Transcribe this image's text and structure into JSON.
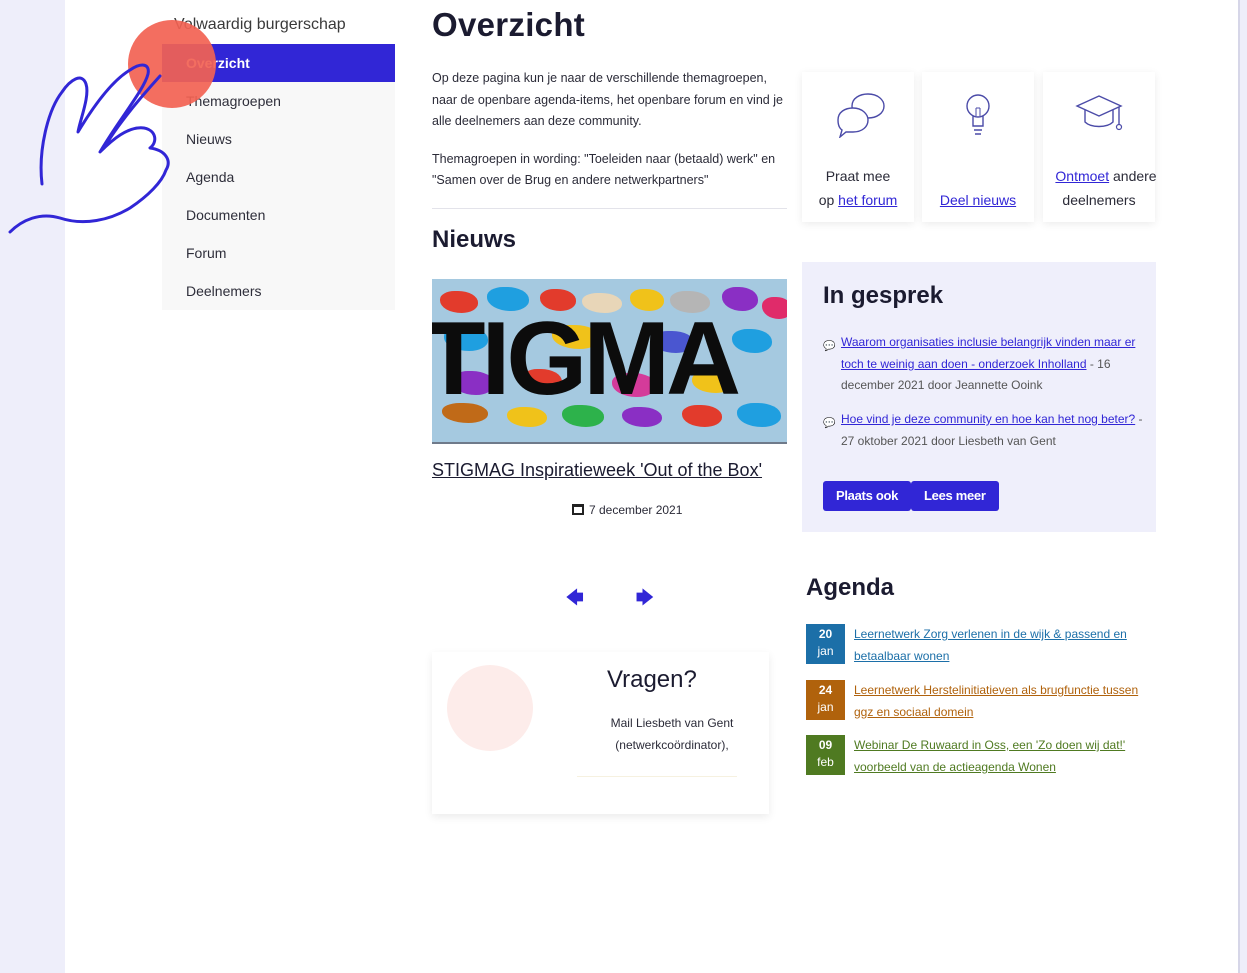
{
  "sidebar": {
    "heading": "Volwaardig burgerschap",
    "items": [
      {
        "label": "Overzicht"
      },
      {
        "label": "Themagroepen"
      },
      {
        "label": "Nieuws"
      },
      {
        "label": "Agenda"
      },
      {
        "label": "Documenten"
      },
      {
        "label": "Forum"
      },
      {
        "label": "Deelnemers"
      }
    ]
  },
  "main": {
    "title": "Overzicht",
    "intro_1": "Op deze pagina kun je naar de verschillende themagroepen, naar de openbare agenda-items, het openbare forum en vind je alle deelnemers aan deze community.",
    "intro_2": "Themagroepen in wording: \"Toeleiden naar (betaald) werk\" en \"Samen over de Brug en andere netwerkpartners\"",
    "news_heading": "Nieuws",
    "news_image_word": "TIGMA",
    "news_link": "STIGMAG Inspiratieweek 'Out of the Box'",
    "news_date": "7 december 2021",
    "prev_arrow": "🡄",
    "next_arrow": "🡆"
  },
  "vragen": {
    "title": "Vragen?",
    "text_1": "Mail  Liesbeth van Gent",
    "text_2": "(netwerkcoördinator),"
  },
  "cards": [
    {
      "pre": "Praat mee",
      "pre2": "op ",
      "link": "het forum",
      "post": "",
      "icon": "chat-bubbles-icon"
    },
    {
      "pre": "",
      "pre2": "",
      "link": "Deel nieuws",
      "post": "",
      "icon": "lightbulb-icon"
    },
    {
      "pre": "",
      "pre2": "",
      "link": "Ontmoet",
      "post": " andere",
      "post2": "deelnemers",
      "icon": "graduation-cap-icon"
    }
  ],
  "gesprek": {
    "title": "In gesprek",
    "items": [
      {
        "link": "Waarom organisaties inclusie belangrijk vinden maar er toch te weinig aan doen - onderzoek Inholland",
        "meta": " - 16 december 2021 door Jeannette Ooink"
      },
      {
        "link": "Hoe vind je deze community en hoe kan het nog beter?",
        "meta": " - 27 oktober 2021 door Liesbeth van Gent"
      }
    ],
    "btn_post": "Plaats ook",
    "btn_more": "Lees meer"
  },
  "agenda": {
    "title": "Agenda",
    "items": [
      {
        "day": "20",
        "month": "jan",
        "text": "Leernetwerk Zorg verlenen in de wijk & passend en betaalbaar wonen",
        "color": "#1c6fa8"
      },
      {
        "day": "24",
        "month": "jan",
        "text": "Leernetwerk Herstelinitiatieven als brugfunctie tussen ggz en sociaal domein",
        "color": "#b0620c"
      },
      {
        "day": "09",
        "month": "feb",
        "text": "Webinar De Ruwaard in Oss, een 'Zo doen wij dat!' voorbeeld van de actieagenda Wonen",
        "color": "#4f7a21"
      }
    ]
  },
  "colors": {
    "accent": "#3126d6",
    "tap": "#f26252"
  }
}
